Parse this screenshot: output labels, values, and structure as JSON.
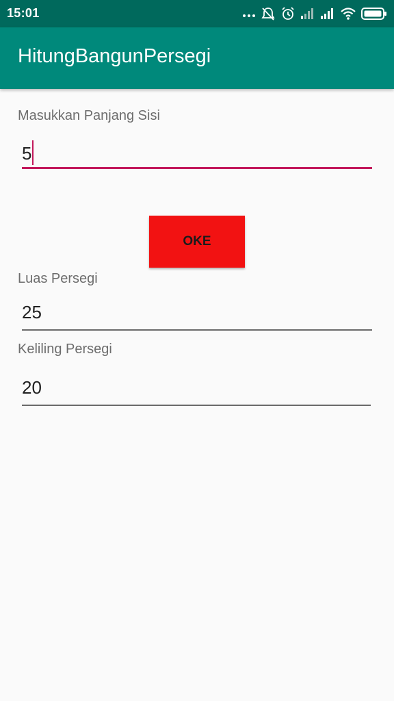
{
  "status_bar": {
    "time": "15:01",
    "icons": [
      "more-dots-icon",
      "alarm-off-icon",
      "alarm-clock-icon",
      "signal-weak-icon",
      "signal-strong-icon",
      "wifi-icon",
      "battery-icon"
    ]
  },
  "app_bar": {
    "title": "HitungBangunPersegi"
  },
  "form": {
    "input_label": "Masukkan Panjang Sisi",
    "input_value": "5",
    "button_label": "OKE"
  },
  "results": {
    "area_label": "Luas Persegi",
    "area_value": "25",
    "perimeter_label": "Keliling Persegi",
    "perimeter_value": "20"
  },
  "colors": {
    "status_bar": "#00695c",
    "app_bar": "#00897b",
    "accent": "#c2185b",
    "button": "#f21212",
    "background": "#fafafa"
  }
}
